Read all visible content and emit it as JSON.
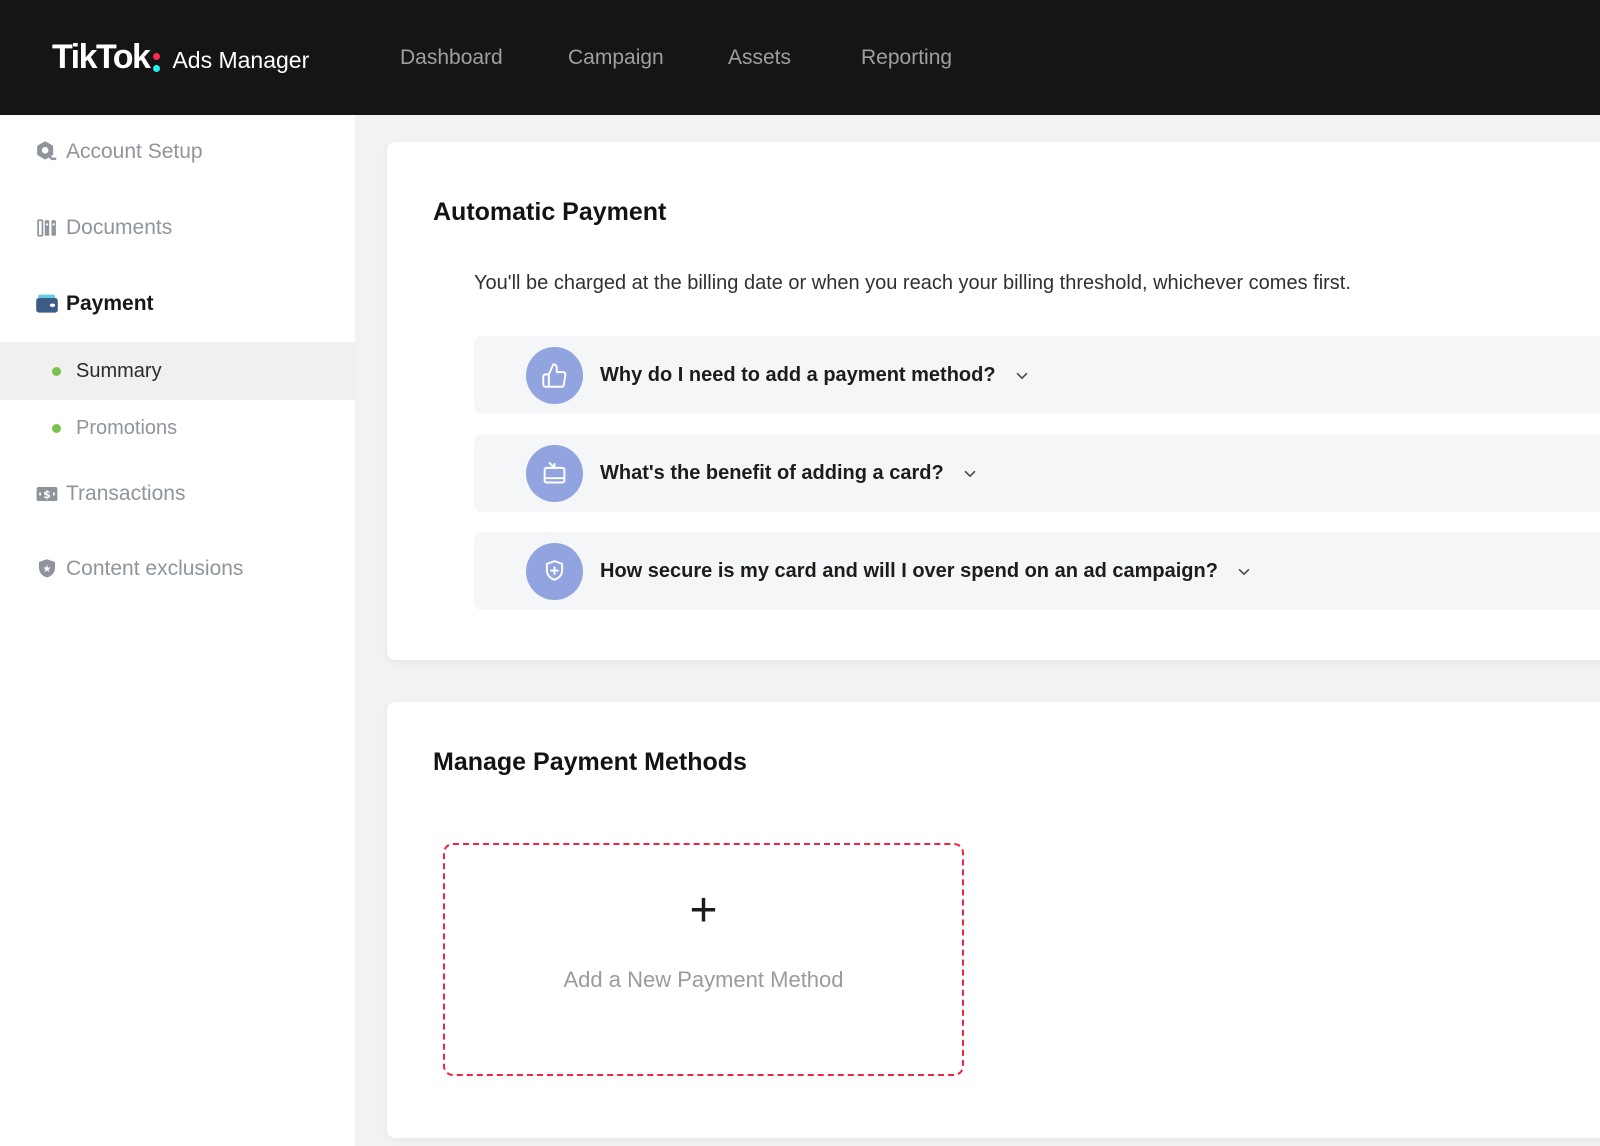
{
  "navbar": {
    "logo": {
      "brand": "TikTok",
      "product": "Ads Manager"
    },
    "items": [
      {
        "label": "Dashboard"
      },
      {
        "label": "Campaign"
      },
      {
        "label": "Assets"
      },
      {
        "label": "Reporting"
      }
    ]
  },
  "sidebar": {
    "items": [
      {
        "label": "Account Setup",
        "icon": "account-setup-icon"
      },
      {
        "label": "Documents",
        "icon": "documents-icon"
      },
      {
        "label": "Payment",
        "icon": "payment-wallet-icon",
        "active": true
      },
      {
        "label": "Summary",
        "type": "sub-item",
        "selected": true
      },
      {
        "label": "Promotions",
        "type": "sub-item",
        "selected": false
      },
      {
        "label": "Transactions",
        "icon": "transactions-icon"
      },
      {
        "label": "Content exclusions",
        "icon": "content-exclusions-icon"
      }
    ]
  },
  "automatic_payment": {
    "title": "Automatic Payment",
    "subtitle": "You'll be charged at the billing date or when you reach your billing threshold, whichever comes first.",
    "faqs": [
      {
        "icon": "thumbs-up-icon",
        "question": "Why do I need to add a payment method?"
      },
      {
        "icon": "credit-card-icon",
        "question": "What's the benefit of adding a card?"
      },
      {
        "icon": "shield-plus-icon",
        "question": "How secure is my card and will I over spend on an ad campaign?"
      }
    ]
  },
  "manage_payment_methods": {
    "title": "Manage Payment Methods",
    "add_button": {
      "plus": "+",
      "label": "Add a New Payment Method"
    }
  },
  "colors": {
    "tiktok_red": "#FE2C55",
    "tiktok_cyan": "#25F4EE",
    "faq_icon_bg": "#91A4E0",
    "dashed_border_red": "#EE2442",
    "sub_item_bullet_green": "#7AC14E",
    "wallet_navy": "#3D5B87",
    "wallet_cyan": "#62CFE0"
  }
}
